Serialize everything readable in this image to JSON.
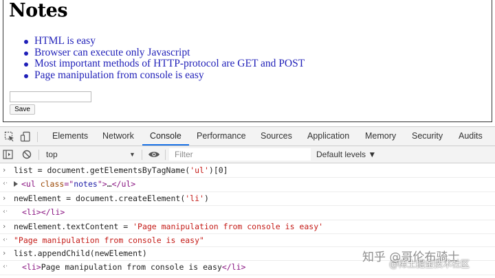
{
  "page": {
    "title": "Notes",
    "notes": [
      "HTML is easy",
      "Browser can execute only Javascript",
      "Most important methods of HTTP-protocol are GET and POST",
      "Page manipulation from console is easy"
    ],
    "note_input_value": "",
    "save_label": "Save"
  },
  "devtools": {
    "tabs": [
      "Elements",
      "Network",
      "Console",
      "Performance",
      "Sources",
      "Application",
      "Memory",
      "Security",
      "Audits"
    ],
    "active_tab": "Console",
    "icons": [
      "inspect-element-icon",
      "device-toolbar-icon"
    ]
  },
  "console_toolbar": {
    "context": "top",
    "filter_placeholder": "Filter",
    "levels_label": "Default levels ▼",
    "icons": [
      "sidebar-toggle-icon",
      "clear-console-icon",
      "eye-icon"
    ]
  },
  "console": {
    "lines": [
      {
        "kind": "input",
        "parts": [
          {
            "t": "list = document.getElementsByTagName(",
            "c": ""
          },
          {
            "t": "'ul'",
            "c": "str"
          },
          {
            "t": ")[0]",
            "c": ""
          }
        ]
      },
      {
        "kind": "result",
        "parts": [
          {
            "t": "<ul ",
            "c": "tag"
          },
          {
            "t": "class",
            "c": "attr"
          },
          {
            "t": "=\"",
            "c": "tag"
          },
          {
            "t": "notes",
            "c": "val"
          },
          {
            "t": "\">",
            "c": "tag"
          },
          {
            "t": "…",
            "c": ""
          },
          {
            "t": "</ul>",
            "c": "tag"
          }
        ],
        "expandable": true
      },
      {
        "kind": "input",
        "parts": [
          {
            "t": "newElement = document.createElement(",
            "c": ""
          },
          {
            "t": "'li'",
            "c": "str"
          },
          {
            "t": ")",
            "c": ""
          }
        ]
      },
      {
        "kind": "result",
        "parts": [
          {
            "t": "<li></li>",
            "c": "tag"
          }
        ],
        "indent": true
      },
      {
        "kind": "input",
        "parts": [
          {
            "t": "newElement.textContent = ",
            "c": ""
          },
          {
            "t": "'Page manipulation from console is easy'",
            "c": "str"
          }
        ]
      },
      {
        "kind": "result",
        "parts": [
          {
            "t": "\"Page manipulation from console is easy\"",
            "c": "str"
          }
        ]
      },
      {
        "kind": "input",
        "parts": [
          {
            "t": "list.appendChild(newElement)",
            "c": ""
          }
        ]
      },
      {
        "kind": "result",
        "parts": [
          {
            "t": "<li>",
            "c": "tag"
          },
          {
            "t": "Page manipulation from console is easy",
            "c": ""
          },
          {
            "t": "</li>",
            "c": "tag"
          }
        ],
        "indent": true
      }
    ],
    "prompt_symbol": "›",
    "result_symbol": "‹·"
  },
  "watermark": {
    "line1": "知乎 @哥伦布骑士",
    "line2": "@稀土掘金技术社区"
  },
  "colors": {
    "link_blue": "#1f1fb8",
    "tab_active_underline": "#1a73e8",
    "console_string": "#c41a16",
    "console_tag": "#881280",
    "console_attr": "#994500"
  }
}
